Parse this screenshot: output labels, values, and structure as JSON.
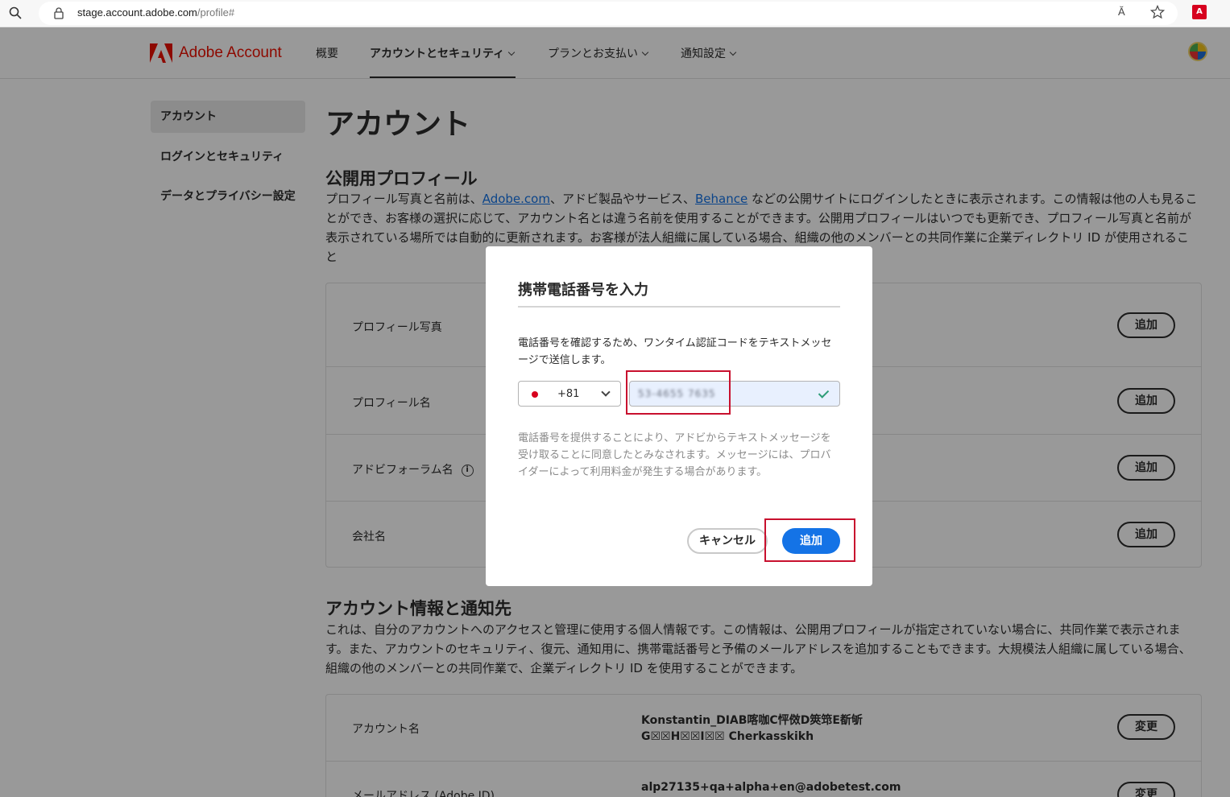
{
  "browser": {
    "url_host": "stage.account.adobe.com",
    "url_path": "/profile#",
    "read_aloud": "Ă",
    "ext_label": "A"
  },
  "header": {
    "brand": "Adobe Account",
    "nav": [
      {
        "label": "概要"
      },
      {
        "label": "アカウントとセキュリティ"
      },
      {
        "label": "プランとお支払い"
      },
      {
        "label": "通知設定"
      }
    ]
  },
  "sidebar": {
    "items": [
      {
        "label": "アカウント"
      },
      {
        "label": "ログインとセキュリティ"
      },
      {
        "label": "データとプライバシー設定"
      }
    ]
  },
  "main": {
    "title": "アカウント",
    "public_profile": {
      "title": "公開用プロフィール",
      "desc_1": "プロフィール写真と名前は、",
      "link_1": "Adobe.com",
      "desc_2": "、アドビ製品やサービス、",
      "link_2": "Behance",
      "desc_3": " などの公開サイトにログインしたときに表示されます。この情報は他の人も見ることができ、お客様の選択に応じて、アカウント名とは違う名前を使用することができます。公開用プロフィールはいつでも更新でき、プロフィール写真と名前が表示されている場所では自動的に更新されます。お客様が法人組織に属している場合、組織の他のメンバーとの共同作業に企業ディレクトリ ID が使用されること",
      "rows": [
        {
          "label": "プロフィール写真",
          "button": "追加"
        },
        {
          "label": "プロフィール名",
          "button": "追加"
        },
        {
          "label": "アドビフォーラム名",
          "button": "追加"
        },
        {
          "label": "会社名",
          "button": "追加"
        }
      ],
      "info_icon": "i"
    },
    "account_info": {
      "title": "アカウント情報と通知先",
      "desc": "これは、自分のアカウントへのアクセスと管理に使用する個人情報です。この情報は、公開用プロフィールが指定されていない場合に、共同作業で表示されます。また、アカウントのセキュリティ、復元、通知用に、携帯電話番号と予備のメールアドレスを追加することもできます。大規模法人組織に属している場合、組織の他のメンバーとの共同作業で、企業ディレクトリ ID を使用することができます。",
      "rows": [
        {
          "label": "アカウント名",
          "value_1": "Konstantin_DIAB喀咖C怦傚D筴筇E斱斪",
          "value_2": "G☒☒H☒☒I☒☒ Cherkasskikh",
          "button": "変更"
        },
        {
          "label": "メールアドレス (Adobe ID)",
          "value_1": "alp27135+qa+alpha+en@adobetest.com",
          "button": "変更"
        }
      ]
    }
  },
  "modal": {
    "title": "携帯電話番号を入力",
    "desc": "電話番号を確認するため、ワンタイム認証コードをテキストメッセージで送信します。",
    "country_code": "+81",
    "phone_value": "53-4655 7635",
    "note": "電話番号を提供することにより、アドビからテキストメッセージを受け取ることに同意したとみなされます。メッセージには、プロバイダーによって利用料金が発生する場合があります。",
    "cancel_label": "キャンセル",
    "add_label": "追加"
  }
}
